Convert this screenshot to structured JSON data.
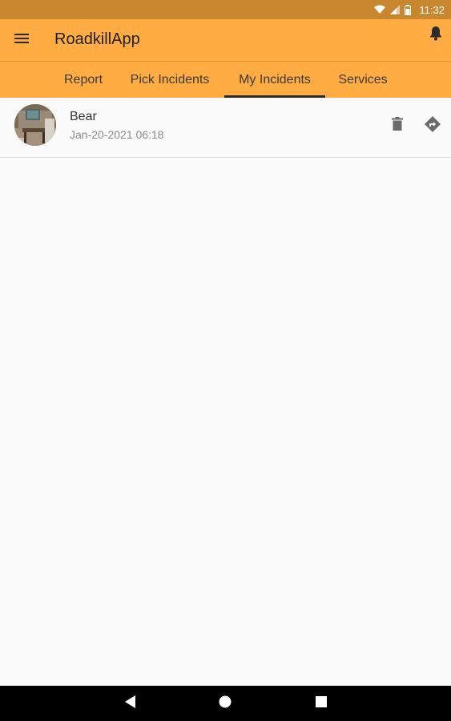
{
  "status_bar": {
    "time": "11:32",
    "icons": [
      "wifi-icon",
      "signal-icon",
      "battery-icon"
    ]
  },
  "app_bar": {
    "title": "RoadkillApp",
    "left_icon": "menu-icon",
    "right_icon": "bell-icon",
    "background_color": "#ffad42"
  },
  "tabs": [
    {
      "label": "Report",
      "selected": false
    },
    {
      "label": "Pick Incidents",
      "selected": false
    },
    {
      "label": "My Incidents",
      "selected": true
    },
    {
      "label": "Services",
      "selected": false
    }
  ],
  "incidents": [
    {
      "title": "Bear",
      "date": "Jan-20-2021 06:18",
      "actions": [
        "delete-icon",
        "directions-icon"
      ]
    }
  ],
  "nav_bar": {
    "buttons": [
      "back-icon",
      "home-icon",
      "recents-icon"
    ]
  }
}
